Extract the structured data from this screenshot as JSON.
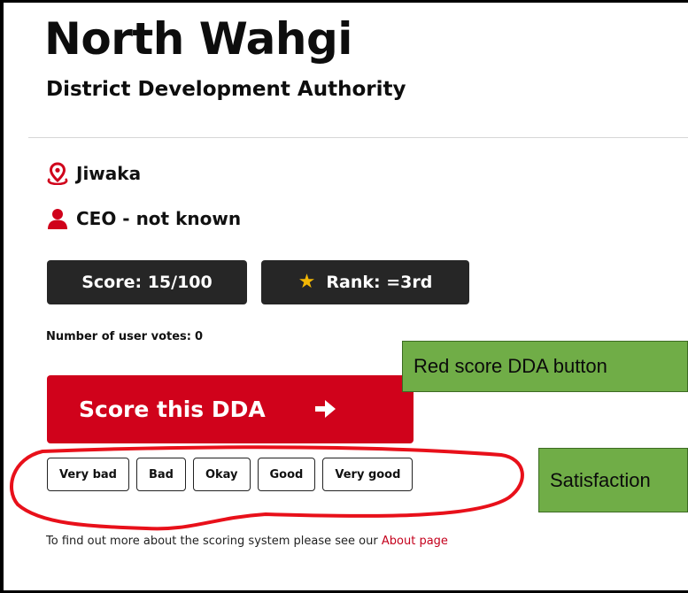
{
  "page": {
    "title": "North Wahgi",
    "subtitle": "District Development Authority"
  },
  "info": {
    "location": "Jiwaka",
    "ceo": "CEO - not known",
    "location_icon": "map-pin-icon",
    "ceo_icon": "person-icon"
  },
  "stats": {
    "score_label": "Score: 15/100",
    "rank_label": "Rank: =3rd",
    "votes_label": "Number of user votes:",
    "votes_value": "0"
  },
  "actions": {
    "score_button_label": "Score this DDA",
    "satisfaction_options": [
      "Very bad",
      "Bad",
      "Okay",
      "Good",
      "Very good"
    ]
  },
  "annotations": {
    "red_button_note": "Red score DDA button",
    "satisfaction_note": "Satisfaction"
  },
  "footer": {
    "text": "To find out more about the scoring system please see our",
    "link_label": "About page"
  },
  "colors": {
    "accent_red": "#d0021b",
    "dark_pill": "#262626",
    "star": "#f2b705",
    "annotation_green": "#70ad47"
  }
}
